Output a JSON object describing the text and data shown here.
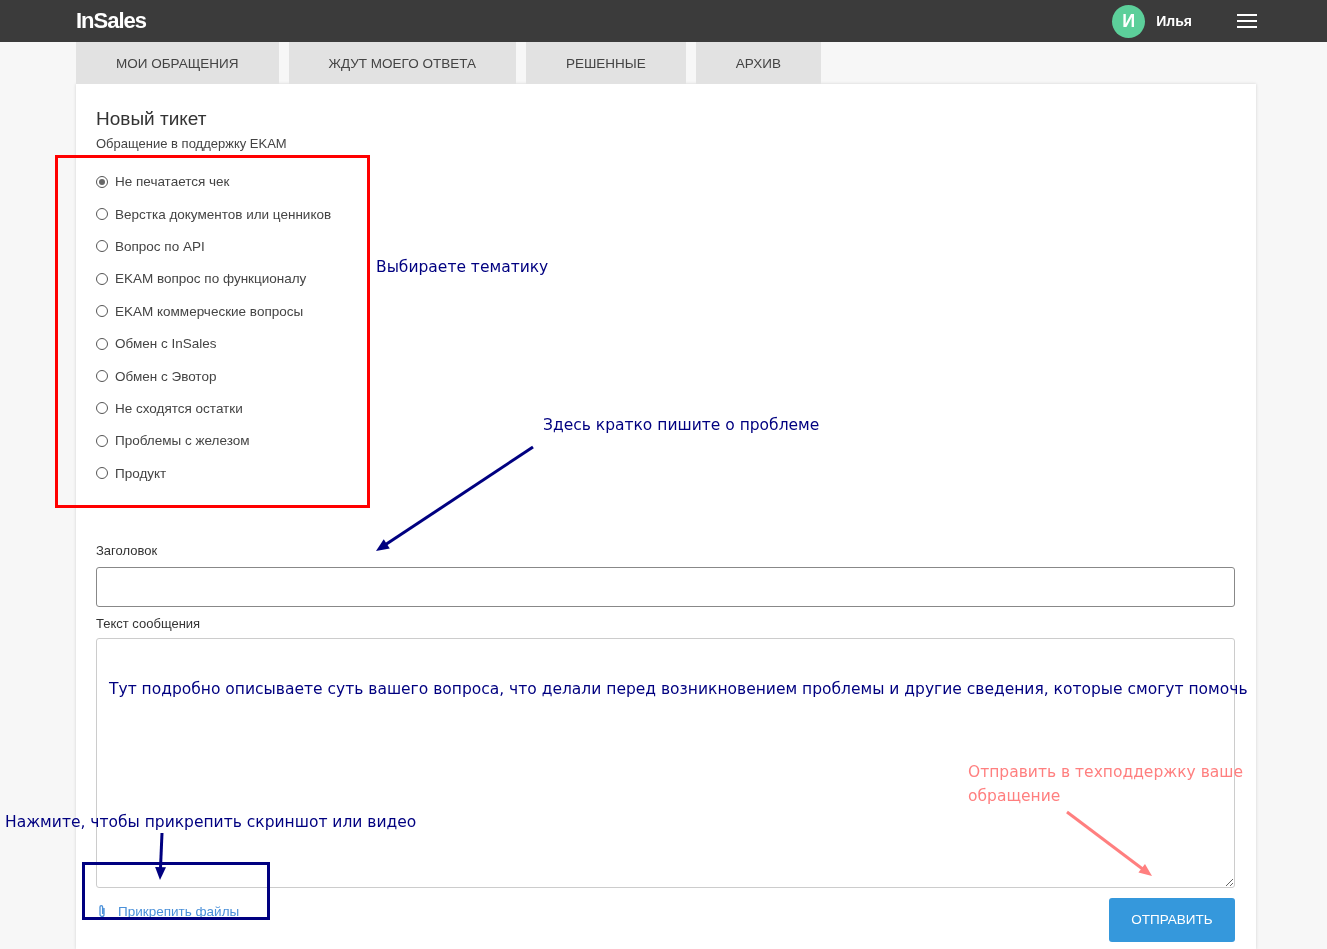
{
  "header": {
    "logo": "InSales",
    "user": {
      "initial": "И",
      "name": "Илья"
    }
  },
  "tabs": [
    {
      "label": "МОИ ОБРАЩЕНИЯ",
      "selected": false
    },
    {
      "label": "ЖДУТ МОЕГО ОТВЕТА",
      "selected": false
    },
    {
      "label": "РЕШЕННЫЕ",
      "selected": false
    },
    {
      "label": "АРХИВ",
      "selected": false
    }
  ],
  "form": {
    "title": "Новый тикет",
    "subtitle": "Обращение в поддержку EKAM",
    "topics": [
      {
        "label": "Не печатается чек",
        "selected": true
      },
      {
        "label": "Верстка документов или ценников",
        "selected": false
      },
      {
        "label": "Вопрос по API",
        "selected": false
      },
      {
        "label": "EKAM вопрос по функционалу",
        "selected": false
      },
      {
        "label": "EKAM коммерческие вопросы",
        "selected": false
      },
      {
        "label": "Обмен с InSales",
        "selected": false
      },
      {
        "label": "Обмен с Эвотор",
        "selected": false
      },
      {
        "label": "Не сходятся остатки",
        "selected": false
      },
      {
        "label": "Проблемы с железом",
        "selected": false
      },
      {
        "label": "Продукт",
        "selected": false
      }
    ],
    "subject_label": "Заголовок",
    "message_label": "Текст сообщения",
    "attach": "Прикрепить файлы",
    "submit": "ОТПРАВИТЬ"
  },
  "annotations": [
    {
      "kind": "frame",
      "color": "#ff0000"
    },
    {
      "kind": "note",
      "text": "Выбираете тематику",
      "color": "#000080"
    },
    {
      "kind": "note",
      "text": "Здесь кратко пишите о проблеме",
      "color": "#000080"
    },
    {
      "kind": "arrow",
      "color": "#000080"
    },
    {
      "kind": "note",
      "text": "Тут подробно описываете суть вашего вопроса, что делали перед возникновением проблемы и другие сведения, которые смогут помочь",
      "color": "#000080"
    },
    {
      "kind": "note",
      "text": "Нажмите, чтобы прикрепить скриншот или видео",
      "color": "#000080"
    },
    {
      "kind": "arrow",
      "color": "#000080"
    },
    {
      "kind": "frame",
      "color": "#000080"
    },
    {
      "kind": "note",
      "text": "Отправить в техподдержку ваше обращение",
      "color": "#ff7f7f"
    },
    {
      "kind": "arrow",
      "color": "#ff7f7f"
    }
  ]
}
